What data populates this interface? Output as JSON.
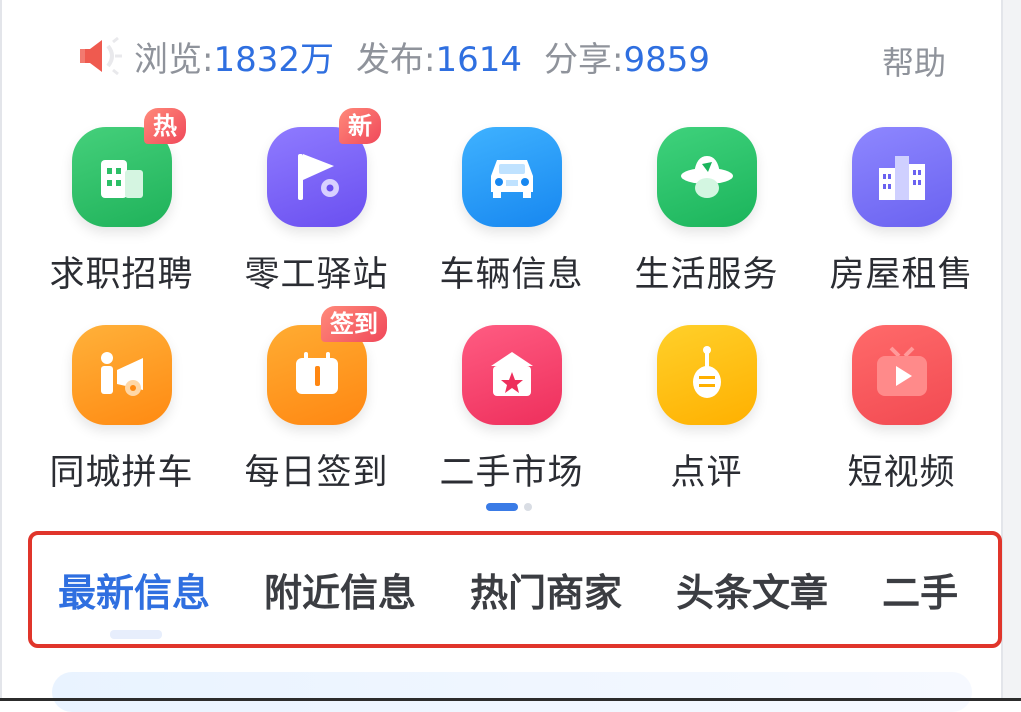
{
  "stats": {
    "views_label": "浏览:",
    "views_value": "1832万",
    "posts_label": "发布:",
    "posts_value": "1614",
    "shares_label": "分享:",
    "shares_value": "9859",
    "help": "帮助"
  },
  "grid": {
    "row1": [
      {
        "label": "求职招聘",
        "icon": "building-icon",
        "badge": "热"
      },
      {
        "label": "零工驿站",
        "icon": "flag-location-icon",
        "badge": "新"
      },
      {
        "label": "车辆信息",
        "icon": "car-icon"
      },
      {
        "label": "生活服务",
        "icon": "cowboy-hat-icon"
      },
      {
        "label": "房屋租售",
        "icon": "city-buildings-icon"
      }
    ],
    "row2": [
      {
        "label": "同城拼车",
        "icon": "person-car-icon"
      },
      {
        "label": "每日签到",
        "icon": "calendar-icon",
        "badge": "签到"
      },
      {
        "label": "二手市场",
        "icon": "shop-star-icon"
      },
      {
        "label": "点评",
        "icon": "pipa-icon"
      },
      {
        "label": "短视频",
        "icon": "tv-play-icon"
      }
    ]
  },
  "pager": {
    "pages": 2,
    "current": 1
  },
  "tabs": [
    "最新信息",
    "附近信息",
    "热门商家",
    "头条文章",
    "二手"
  ],
  "colors": {
    "accent": "#2f6fe0",
    "highlight_border": "#e0352b",
    "badge": "#f0485a"
  }
}
